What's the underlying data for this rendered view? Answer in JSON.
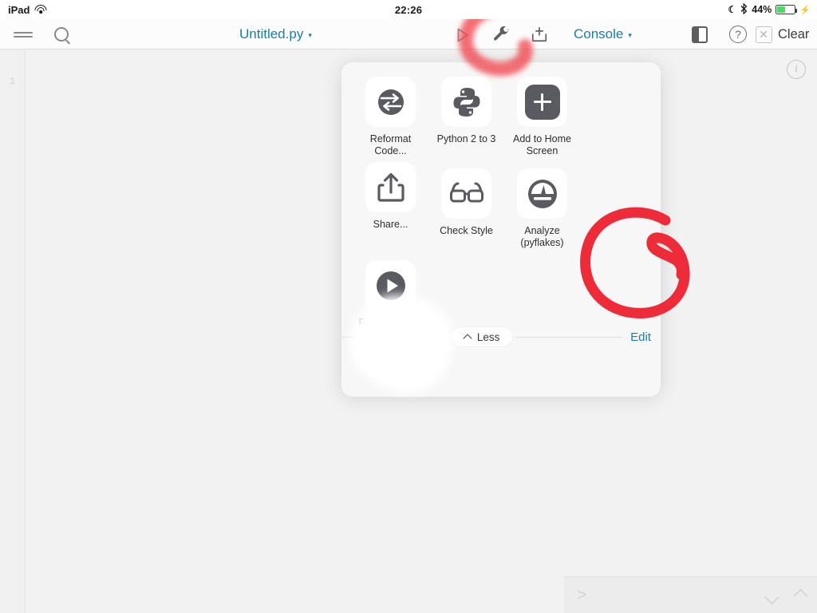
{
  "status_bar": {
    "device": "iPad",
    "wifi_icon": "wifi-icon",
    "time": "22:26",
    "dnd_icon": "moon-icon",
    "bluetooth_icon": "bluetooth-icon",
    "battery_percent": "44%",
    "battery_level": 44,
    "battery_icon": "battery-icon",
    "charging_icon": "lightning-bolt-icon"
  },
  "toolbar": {
    "menu_icon": "hamburger-menu-icon",
    "search_icon": "search-icon",
    "filename": "Untitled.py",
    "filename_caret": "▾",
    "run_icon": "play-triangle-icon",
    "wrench_icon": "wrench-icon",
    "newtab_icon": "add-tab-icon",
    "console_label": "Console",
    "console_caret": "▾",
    "panel_icon": "side-panel-icon",
    "help_icon": "question-mark-icon",
    "close_icon": "close-x-icon",
    "clear_label": "Clear"
  },
  "editor": {
    "line_numbers": [
      "1"
    ],
    "content": ""
  },
  "console": {
    "info_icon": "info-icon",
    "info_glyph": "i",
    "prompt": ">",
    "placeholder": "",
    "scroll_down_icon": "chevron-down-icon",
    "scroll_up_icon": "chevron-up-icon"
  },
  "popup": {
    "actions": [
      {
        "label": "Reformat Code...",
        "icon": "reformat-code-icon",
        "filled": false
      },
      {
        "label": "Python 2 to 3",
        "icon": "python-logo-icon",
        "filled": false
      },
      {
        "label": "Add to Home Screen",
        "icon": "plus-square-icon",
        "filled": true
      },
      {
        "label": "Share...",
        "icon": "share-upload-icon",
        "filled": false
      },
      {
        "label": "Check Style",
        "icon": "glasses-icon",
        "filled": false
      },
      {
        "label": "Analyze (pyflakes)",
        "icon": "gauge-icon",
        "filled": false
      },
      {
        "label": "Run Options...",
        "icon": "play-circle-icon",
        "filled": false
      }
    ],
    "less_label": "Less",
    "less_chevron_icon": "chevron-up-icon",
    "edit_label": "Edit",
    "redaction_mark": "white-scribble-redaction"
  },
  "annotations": {
    "wrench_circle": {
      "shape": "hand-drawn-circle",
      "color": "#f0484f",
      "blurred": true,
      "target": "wrench-icon"
    },
    "edit_circle": {
      "shape": "hand-drawn-circle",
      "color": "#ee2b38",
      "blurred": false,
      "target": "edit-link"
    }
  },
  "colors": {
    "accent": "#1b7fa3",
    "annotation_red": "#ee2b38",
    "icon_gray": "#5a5a63",
    "battery_green": "#4cd964"
  }
}
